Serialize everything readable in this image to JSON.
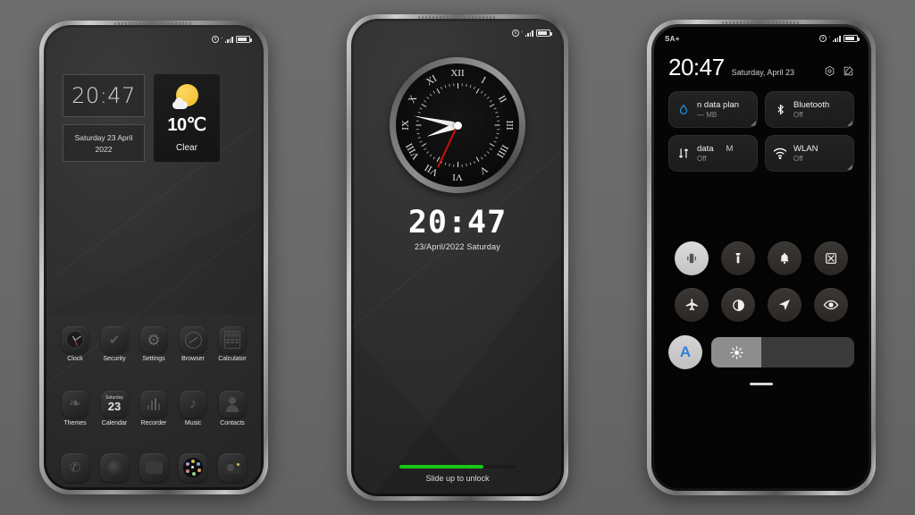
{
  "background": {
    "color": "#6c6c6c"
  },
  "phone_home": {
    "name": "home-screen",
    "statusbar": {
      "left": "",
      "icons": [
        "alarm-icon",
        "signal-icon",
        "battery-icon"
      ]
    },
    "clock_widget": {
      "time": "20:47"
    },
    "date_widget": {
      "line1": "Saturday 23 April",
      "line2": "2022"
    },
    "weather_widget": {
      "icon": "sun-cloud-icon",
      "temperature": "10℃",
      "condition": "Clear",
      "accent": "#f0b72c"
    },
    "apps_row1": [
      {
        "label": "Clock",
        "icon": "clock-icon"
      },
      {
        "label": "Security",
        "icon": "shield-check-icon"
      },
      {
        "label": "Settings",
        "icon": "gears-icon"
      },
      {
        "label": "Browser",
        "icon": "compass-icon"
      },
      {
        "label": "Calculator",
        "icon": "calculator-icon"
      }
    ],
    "apps_row2": [
      {
        "label": "Themes",
        "icon": "themes-icon"
      },
      {
        "label": "Calendar",
        "icon": "calendar-icon",
        "day_name": "Saturday",
        "day_number": "23"
      },
      {
        "label": "Recorder",
        "icon": "recorder-icon"
      },
      {
        "label": "Music",
        "icon": "music-note-icon"
      },
      {
        "label": "Contacts",
        "icon": "contacts-icon"
      }
    ],
    "dock": [
      {
        "label": "Phone",
        "icon": "phone-handset-icon"
      },
      {
        "label": "Camera",
        "icon": "camera-lens-icon"
      },
      {
        "label": "Messages",
        "icon": "messages-icon"
      },
      {
        "label": "Gallery",
        "icon": "flower-gallery-icon"
      },
      {
        "label": "Camera",
        "icon": "camera-icon"
      }
    ]
  },
  "phone_lock": {
    "name": "lock-screen",
    "analog_clock": {
      "numerals": [
        "XII",
        "I",
        "II",
        "III",
        "IIII",
        "V",
        "VI",
        "VII",
        "VIII",
        "IX",
        "X",
        "XI"
      ],
      "hour_angle_deg": 250,
      "minute_angle_deg": 282,
      "second_angle_deg": 205,
      "second_hand_color": "#cc1111"
    },
    "digital_time": "20:47",
    "digital_date": "23/April/2022   Saturday",
    "unlock_hint": "Slide up  to unlock",
    "slider": {
      "progress_pct": 72,
      "color": "#18c718"
    }
  },
  "phone_control": {
    "name": "control-center",
    "statusbar": {
      "left": "SA+"
    },
    "time": "20:47",
    "date": "Saturday, April 23",
    "header_icons": [
      "settings-icon",
      "edit-icon"
    ],
    "tiles": [
      {
        "title": "n data plan",
        "sub": "— MB",
        "icon": "data-drop-icon",
        "icon_color": "#1b97e0",
        "expandable": true
      },
      {
        "title": "Bluetooth",
        "sub": "Off",
        "icon": "bluetooth-icon",
        "icon_color": "#ffffff",
        "expandable": true
      },
      {
        "title": "data",
        "sub": "Off",
        "trailing": "M",
        "icon": "mobile-data-icon",
        "icon_color": "#ffffff",
        "expandable": false
      },
      {
        "title": "WLAN",
        "sub": "Off",
        "icon": "wifi-icon",
        "icon_color": "#ffffff",
        "expandable": true
      }
    ],
    "toggles_row1": [
      {
        "name": "vibrate-icon",
        "active": true
      },
      {
        "name": "flashlight-icon",
        "active": false
      },
      {
        "name": "bell-icon",
        "active": false
      },
      {
        "name": "screenshot-icon",
        "active": false
      }
    ],
    "toggles_row2": [
      {
        "name": "airplane-icon",
        "active": false
      },
      {
        "name": "dark-mode-icon",
        "active": false
      },
      {
        "name": "location-icon",
        "active": false
      },
      {
        "name": "eye-comfort-icon",
        "active": false
      }
    ],
    "brightness": {
      "auto_label": "A",
      "auto_color": "#2f7ddb",
      "level_pct": 35,
      "icon": "brightness-sun-icon"
    },
    "drag_handle": "panel-drag-handle"
  }
}
